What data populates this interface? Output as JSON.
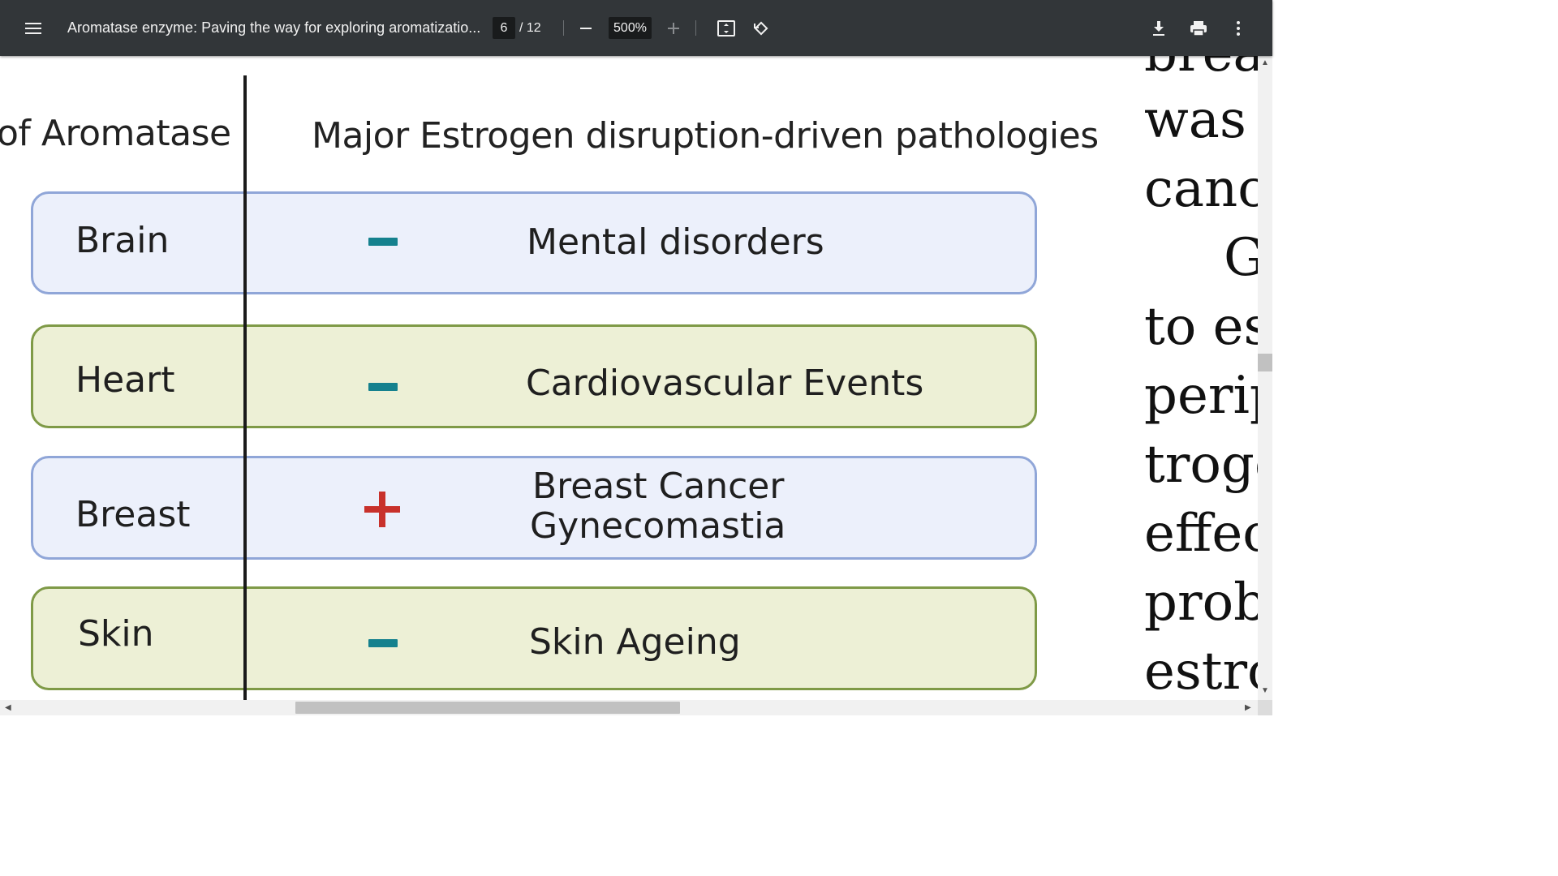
{
  "toolbar": {
    "title": "Aromatase enzyme: Paving the way for exploring aromatizatio...",
    "page_current": "6",
    "page_total": "/ 12",
    "zoom": "500%",
    "icons": [
      "menu-icon",
      "zoom-out-icon",
      "zoom-in-icon",
      "fit-page-icon",
      "rotate-icon",
      "download-icon",
      "print-icon",
      "more-vert-icon"
    ]
  },
  "figure": {
    "header_left": "of Aromatase",
    "header_right": "Major Estrogen disruption-driven pathologies",
    "rows": [
      {
        "organ": "Brain",
        "sign": "minus",
        "pathology": [
          "Mental disorders"
        ],
        "color": "blue"
      },
      {
        "organ": "Heart",
        "sign": "minus",
        "pathology": [
          "Cardiovascular Events"
        ],
        "color": "green"
      },
      {
        "organ": "Breast",
        "sign": "plus",
        "pathology": [
          "Breast Cancer",
          "Gynecomastia"
        ],
        "color": "blue"
      },
      {
        "organ": "Skin",
        "sign": "minus",
        "pathology": [
          "Skin Ageing"
        ],
        "color": "green"
      }
    ],
    "colors": {
      "blue_fill": "#ecf0fb",
      "blue_border": "#90a6d8",
      "green_fill": "#edf0d6",
      "green_border": "#7f9a47",
      "minus": "#15818e",
      "plus": "#c8312b"
    }
  },
  "side_text": {
    "lines": [
      "breas",
      "was",
      "canc",
      "G",
      "to es",
      "perip",
      "troge",
      "effec",
      "prob",
      "estro"
    ]
  }
}
